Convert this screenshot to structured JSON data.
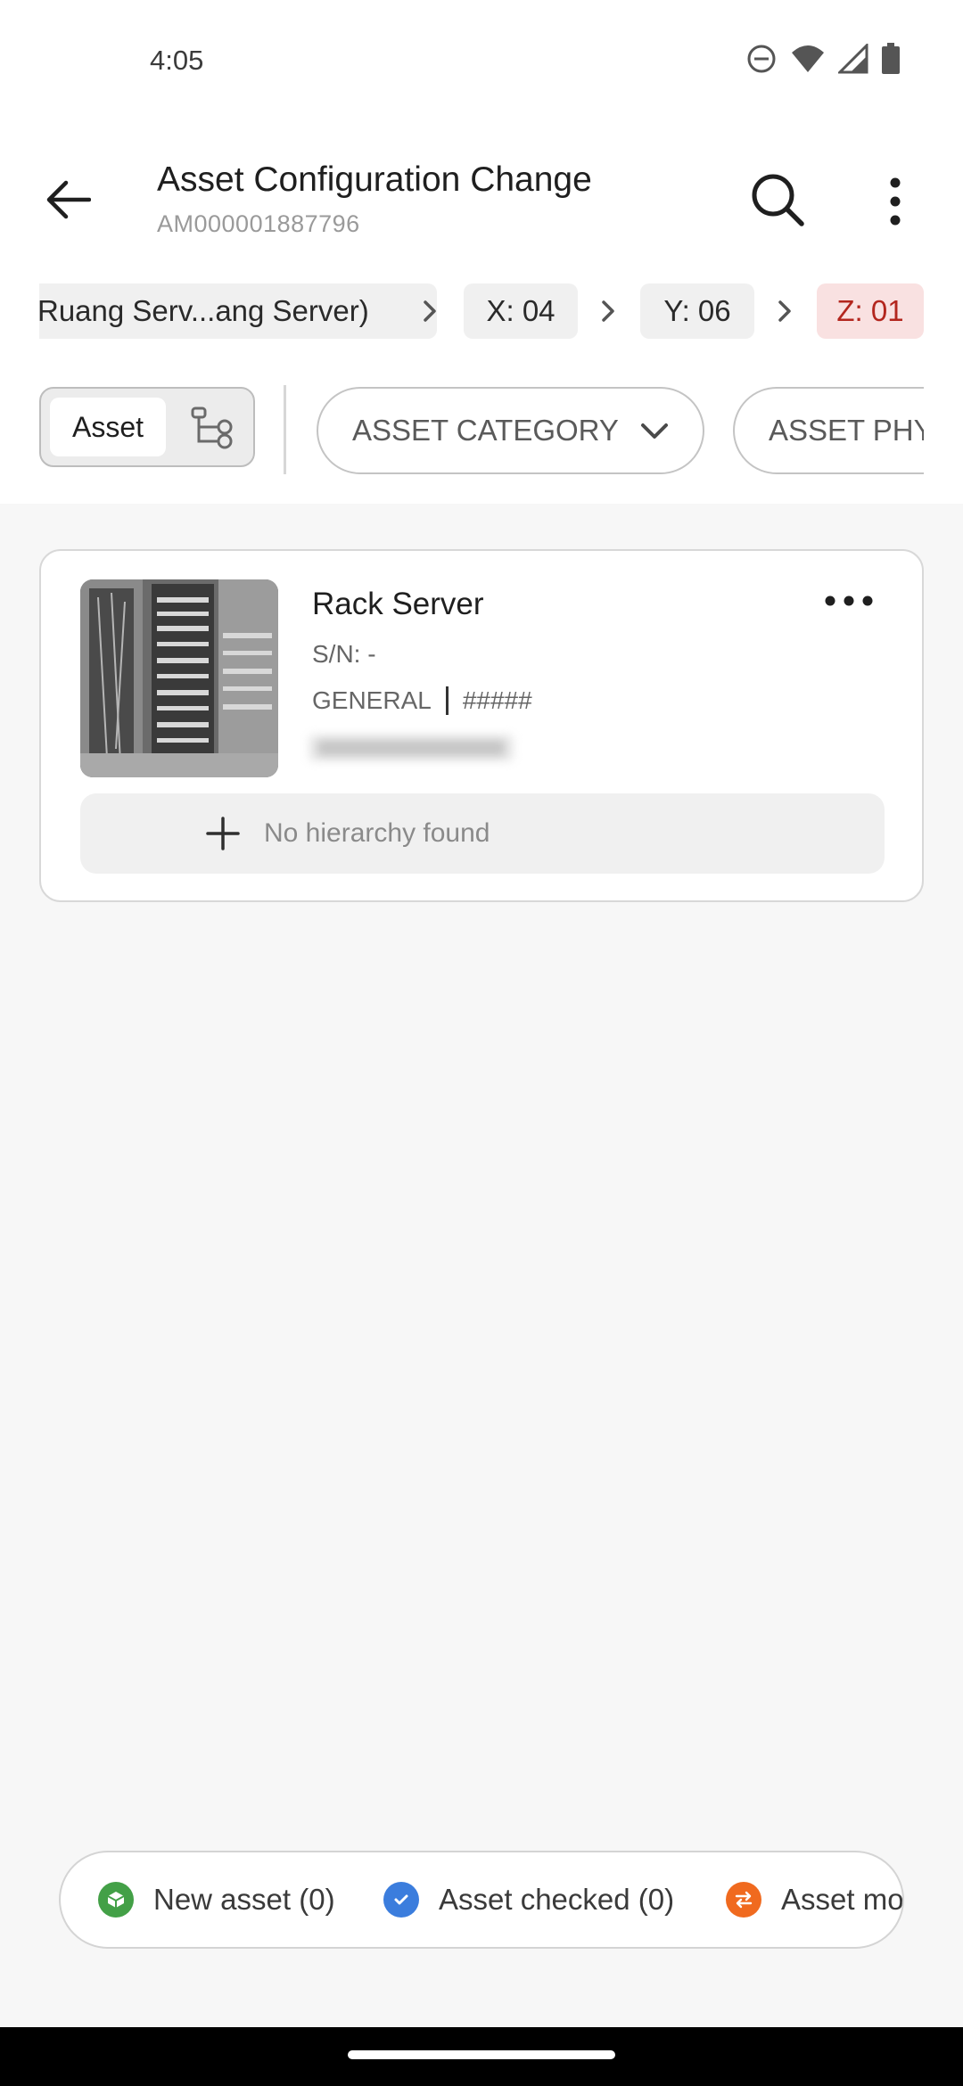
{
  "status_bar": {
    "time": "4:05",
    "icons": [
      "dnd-icon",
      "wifi-icon",
      "signal-icon",
      "battery-icon"
    ]
  },
  "app_bar": {
    "title": "Asset Configuration Change",
    "subtitle": "AM000001887796",
    "back_icon": "arrow-left-icon",
    "search_icon": "search-icon",
    "more_icon": "more-vertical-icon"
  },
  "breadcrumb": {
    "path": "Ruang Serv...ang Server)",
    "x": "X: 04",
    "y": "Y: 06",
    "z": "Z: 01"
  },
  "filters": {
    "segment_asset": "Asset",
    "category": "ASSET CATEGORY",
    "physical": "ASSET PHY"
  },
  "asset_card": {
    "name": "Rack Server",
    "serial": "S/N: -",
    "type": "GENERAL",
    "code": "#####",
    "hierarchy_text": "No hierarchy found"
  },
  "legend": {
    "new_asset": "New asset (0)",
    "asset_checked": "Asset checked (0)",
    "asset_moved": "Asset mo",
    "colors": {
      "new": "#43a047",
      "checked": "#3b7ddd",
      "moved": "#f06a1f"
    }
  },
  "colors": {
    "z_chip_bg": "#f9e1e1",
    "z_chip_text": "#b3261e"
  }
}
